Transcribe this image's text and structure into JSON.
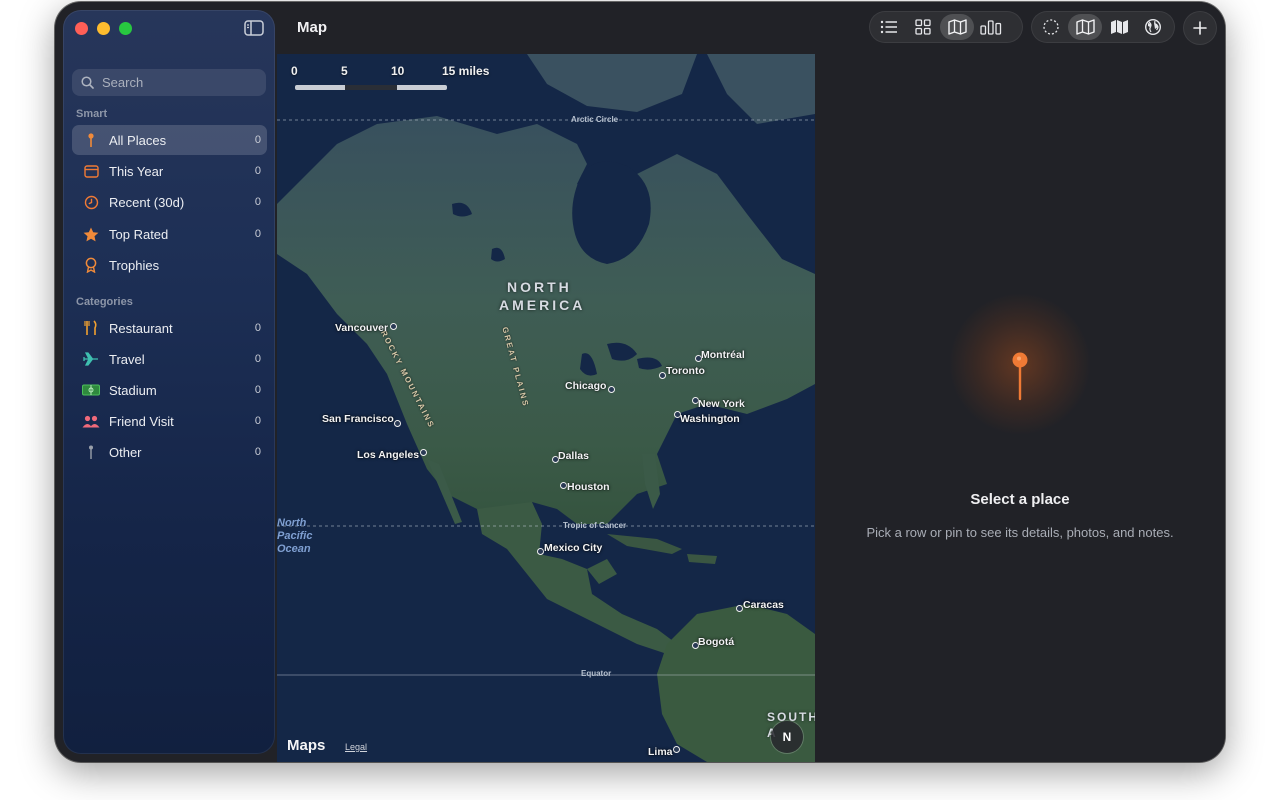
{
  "window": {
    "title": "Map"
  },
  "sidebar": {
    "search_placeholder": "Search",
    "smart_title": "Smart",
    "smart_items": [
      {
        "label": "All Places",
        "count": "0",
        "icon": "pin-icon",
        "color": "#f08a3a",
        "active": true
      },
      {
        "label": "This Year",
        "count": "0",
        "icon": "calendar-icon",
        "color": "#f07a35"
      },
      {
        "label": "Recent (30d)",
        "count": "0",
        "icon": "clock-icon",
        "color": "#f07a35"
      },
      {
        "label": "Top Rated",
        "count": "0",
        "icon": "star-icon",
        "color": "#f08a3a"
      },
      {
        "label": "Trophies",
        "count": "",
        "icon": "trophy-icon",
        "color": "#f08a3a"
      }
    ],
    "categories_title": "Categories",
    "category_items": [
      {
        "label": "Restaurant",
        "count": "0",
        "icon": "fork-knife-icon",
        "color": "#f0a030"
      },
      {
        "label": "Travel",
        "count": "0",
        "icon": "airplane-icon",
        "color": "#3fc0b0"
      },
      {
        "label": "Stadium",
        "count": "0",
        "icon": "stadium-icon",
        "color": "#4cc05a"
      },
      {
        "label": "Friend Visit",
        "count": "0",
        "icon": "people-icon",
        "color": "#f06a7a"
      },
      {
        "label": "Other",
        "count": "0",
        "icon": "pin-gray-icon",
        "color": "#9aa0aa"
      }
    ]
  },
  "toolbar": {
    "view_buttons": [
      "list-icon",
      "grid-icon",
      "map-icon",
      "bar-chart-icon"
    ],
    "selected_view": "map-icon",
    "map_style_buttons": [
      "dashed-circle-icon",
      "map-outline-icon",
      "map-filled-icon",
      "globe-icon"
    ],
    "selected_style": "map-outline-icon",
    "add_icon": "plus-icon"
  },
  "map": {
    "scale_labels": [
      "0",
      "5",
      "10",
      "15 miles"
    ],
    "region_lines": [
      "NORTH",
      "AMERICA"
    ],
    "features": [
      "ROCKY MOUNTAINS",
      "GREAT PLAINS"
    ],
    "lines": {
      "arctic": "Arctic Circle",
      "cancer": "Tropic of Cancer",
      "equator": "Equator"
    },
    "ocean_lines": [
      "North",
      "Pacific",
      "Ocean"
    ],
    "south_label": "SOUTH A",
    "cities": [
      "Vancouver",
      "Montréal",
      "Toronto",
      "Chicago",
      "New York",
      "Washington",
      "San Francisco",
      "Los Angeles",
      "Dallas",
      "Houston",
      "Mexico City",
      "Caracas",
      "Bogotá",
      "Lima"
    ],
    "logo": "Maps",
    "legal": "Legal",
    "compass": "N"
  },
  "detail": {
    "title": "Select a place",
    "subtitle": "Pick a row or pin to see its details, photos, and notes."
  }
}
